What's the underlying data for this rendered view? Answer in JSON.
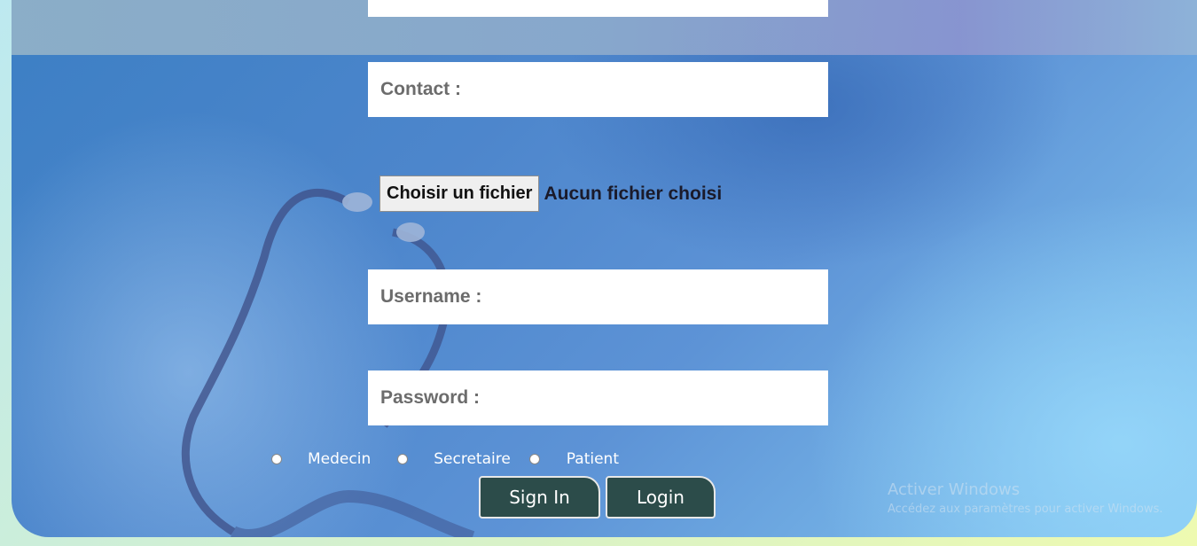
{
  "form": {
    "contact_label": "Contact :",
    "file_button": "Choisir un fichier",
    "file_status": "Aucun fichier choisi",
    "username_label": "Username :",
    "password_label": "Password :",
    "roles": [
      "Medecin",
      "Secretaire",
      "Patient"
    ],
    "signin_label": "Sign In",
    "login_label": "Login"
  },
  "watermark": {
    "title": "Activer Windows",
    "subtitle": "Accédez aux paramètres pour activer Windows."
  },
  "colors": {
    "button_bg": "#2c4c4a",
    "field_bg": "#ffffff",
    "label_color": "#6c6c6c"
  }
}
